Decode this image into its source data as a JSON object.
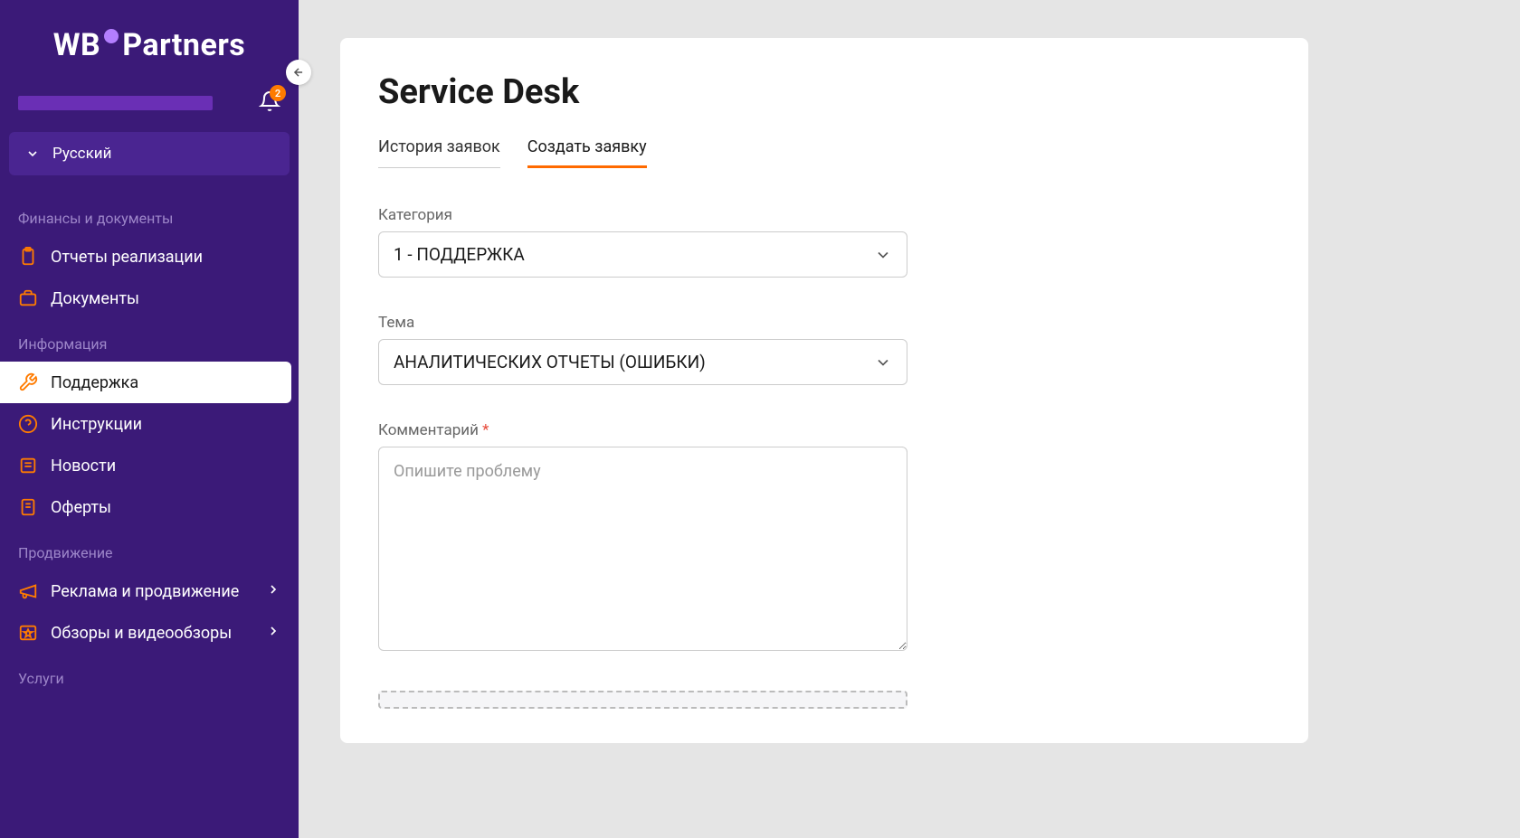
{
  "brand": {
    "part1": "WB",
    "part2": "Partners"
  },
  "notifications": {
    "count": "2"
  },
  "language": {
    "label": "Русский"
  },
  "sections": {
    "finances": {
      "title": "Финансы и документы",
      "items": [
        {
          "label": "Отчеты реализации"
        },
        {
          "label": "Документы"
        }
      ]
    },
    "info": {
      "title": "Информация",
      "items": [
        {
          "label": "Поддержка"
        },
        {
          "label": "Инструкции"
        },
        {
          "label": "Новости"
        },
        {
          "label": "Оферты"
        }
      ]
    },
    "promo": {
      "title": "Продвижение",
      "items": [
        {
          "label": "Реклама и продвижение"
        },
        {
          "label": "Обзоры и видеообзоры"
        }
      ]
    },
    "services": {
      "title": "Услуги"
    }
  },
  "page": {
    "title": "Service Desk",
    "tabs": {
      "history": "История заявок",
      "create": "Создать заявку"
    },
    "form": {
      "category_label": "Категория",
      "category_value": "1 - ПОДДЕРЖКА",
      "topic_label": "Тема",
      "topic_value": "АНАЛИТИЧЕСКИХ ОТЧЕТЫ (ОШИБКИ)",
      "comment_label": "Комментарий",
      "comment_placeholder": "Опишите проблему"
    }
  }
}
